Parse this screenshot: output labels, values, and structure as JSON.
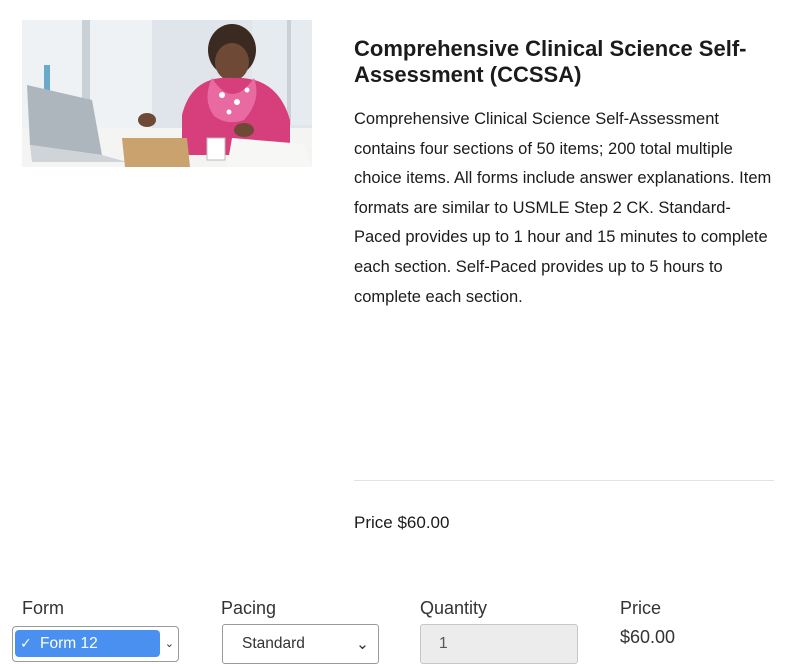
{
  "product": {
    "image_alt": "Student studying at a laptop",
    "title": "Comprehensive Clinical Science Self-Assessment (CCSSA)",
    "description": "Comprehensive Clinical Science Self-Assessment contains four sections of 50 items; 200 total multiple choice items. All forms include answer explanations. Item formats are similar to USMLE Step 2 CK. Standard-Paced provides up to 1 hour and 15 minutes to complete each section. Self-Paced provides up to 5 hours to complete each section.",
    "price_text": "Price $60.00"
  },
  "purchase": {
    "form_label": "Form",
    "form_selected": "Form 12",
    "pacing_label": "Pacing",
    "pacing_selected": "Standard",
    "quantity_label": "Quantity",
    "quantity_value": "1",
    "price_label": "Price",
    "price_value": "$60.00"
  },
  "icons": {
    "check": "✓",
    "chevron": "⌄"
  },
  "colors": {
    "highlight": "#4a90f0",
    "disabled_bg": "#ececec"
  }
}
